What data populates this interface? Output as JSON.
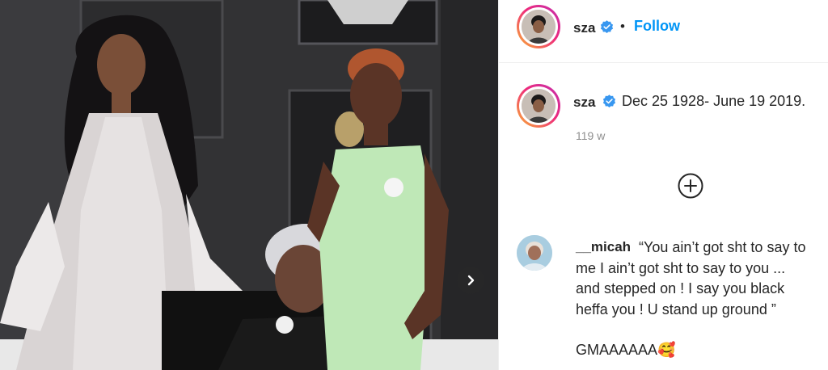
{
  "post": {
    "username": "sza",
    "header_separator": "•",
    "follow_label": "Follow",
    "caption": "Dec 25 1928- June 19 2019.",
    "time_ago": "119 w",
    "accent_color": "#0095f6",
    "icons": {
      "verified": "verified-badge-icon",
      "next": "chevron-right-icon",
      "add": "plus-circle-icon"
    }
  },
  "comment": {
    "username": "__micah",
    "lines": [
      "“You ain’t got sht to say to",
      "me I ain’t got sht to say to you ...",
      "and stepped on ! I say you black",
      "heffa you ! U stand up ground ”",
      "GMAAAAAA🥰"
    ]
  }
}
